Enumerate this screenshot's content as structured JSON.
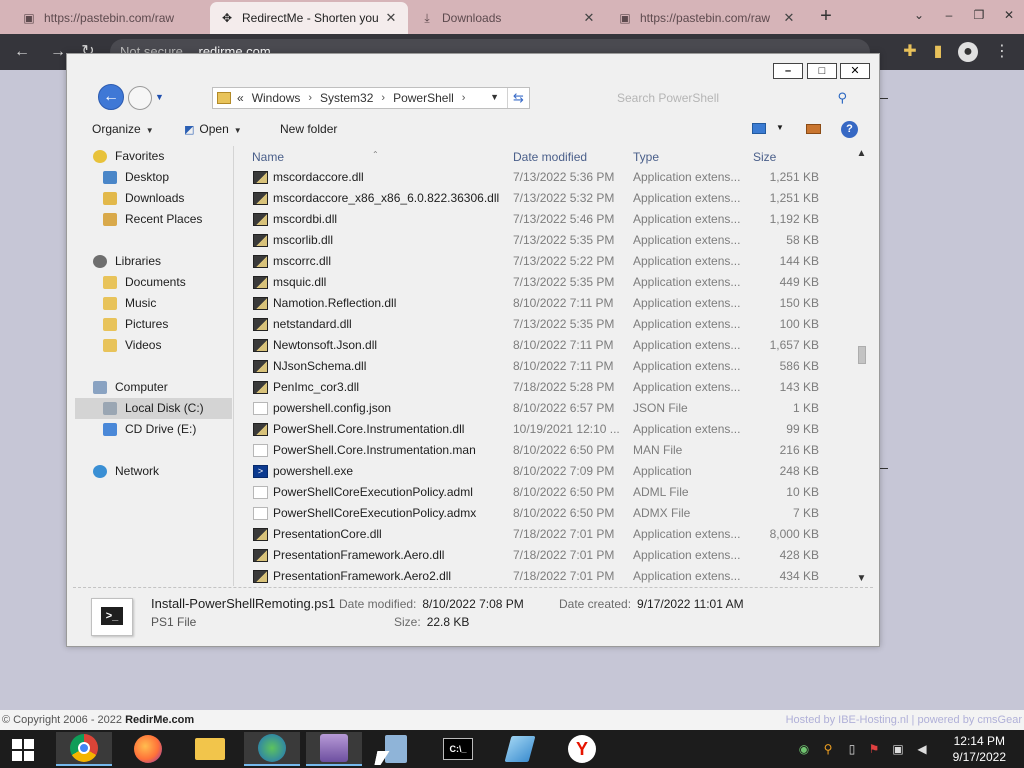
{
  "browser": {
    "tabs": [
      {
        "title": "https://pastebin.com/raw",
        "favicon": "pastebin-icon",
        "active": false
      },
      {
        "title": "RedirectMe - Shorten your",
        "favicon": "redirectme-icon",
        "active": true
      },
      {
        "title": "Downloads",
        "favicon": "download-icon",
        "active": false
      },
      {
        "title": "https://pastebin.com/raw",
        "favicon": "pastebin-icon",
        "active": false
      }
    ],
    "address": {
      "security": "Not secure",
      "url": "redirme.com"
    },
    "footer": {
      "copyright_prefix": "© Copyright 2006 - 2022",
      "copyright_brand": "RedirMe.com",
      "hosted": "Hosted by IBE-Hosting.nl",
      "sep": "|",
      "powered": "powered by cmsGear"
    }
  },
  "explorer": {
    "window_controls": {
      "minimize": "–",
      "maximize": "□",
      "close": "✕"
    },
    "breadcrumb": {
      "overflow": "«",
      "items": [
        "Windows",
        "System32",
        "PowerShell"
      ]
    },
    "search_placeholder": "Search PowerShell",
    "commands": {
      "organize": "Organize",
      "open": "Open",
      "new_folder": "New folder"
    },
    "nav": [
      {
        "label": "Favorites",
        "level": 0,
        "icon": "star-icon"
      },
      {
        "label": "Desktop",
        "level": 1,
        "icon": "desktop-icon"
      },
      {
        "label": "Downloads",
        "level": 1,
        "icon": "downloads-folder-icon"
      },
      {
        "label": "Recent Places",
        "level": 1,
        "icon": "recent-places-icon"
      },
      {
        "label": "Libraries",
        "level": 0,
        "icon": "libraries-icon"
      },
      {
        "label": "Documents",
        "level": 1,
        "icon": "documents-icon"
      },
      {
        "label": "Music",
        "level": 1,
        "icon": "music-icon"
      },
      {
        "label": "Pictures",
        "level": 1,
        "icon": "pictures-icon"
      },
      {
        "label": "Videos",
        "level": 1,
        "icon": "videos-icon"
      },
      {
        "label": "Computer",
        "level": 0,
        "icon": "computer-icon"
      },
      {
        "label": "Local Disk (C:)",
        "level": 1,
        "icon": "drive-icon",
        "selected": true
      },
      {
        "label": "CD Drive (E:)",
        "level": 1,
        "icon": "cd-drive-icon"
      },
      {
        "label": "Network",
        "level": 0,
        "icon": "network-icon"
      }
    ],
    "columns": {
      "name": "Name",
      "date": "Date modified",
      "type": "Type",
      "size": "Size"
    },
    "files": [
      {
        "name": "mscordaccore.dll",
        "date": "7/13/2022 5:36 PM",
        "type": "Application extens...",
        "size": "1,251 KB",
        "icon": "dll"
      },
      {
        "name": "mscordaccore_x86_x86_6.0.822.36306.dll",
        "date": "7/13/2022 5:32 PM",
        "type": "Application extens...",
        "size": "1,251 KB",
        "icon": "dll"
      },
      {
        "name": "mscordbi.dll",
        "date": "7/13/2022 5:46 PM",
        "type": "Application extens...",
        "size": "1,192 KB",
        "icon": "dll"
      },
      {
        "name": "mscorlib.dll",
        "date": "7/13/2022 5:35 PM",
        "type": "Application extens...",
        "size": "58 KB",
        "icon": "dll"
      },
      {
        "name": "mscorrc.dll",
        "date": "7/13/2022 5:22 PM",
        "type": "Application extens...",
        "size": "144 KB",
        "icon": "dll"
      },
      {
        "name": "msquic.dll",
        "date": "7/13/2022 5:35 PM",
        "type": "Application extens...",
        "size": "449 KB",
        "icon": "dll"
      },
      {
        "name": "Namotion.Reflection.dll",
        "date": "8/10/2022 7:11 PM",
        "type": "Application extens...",
        "size": "150 KB",
        "icon": "dll"
      },
      {
        "name": "netstandard.dll",
        "date": "7/13/2022 5:35 PM",
        "type": "Application extens...",
        "size": "100 KB",
        "icon": "dll"
      },
      {
        "name": "Newtonsoft.Json.dll",
        "date": "8/10/2022 7:11 PM",
        "type": "Application extens...",
        "size": "1,657 KB",
        "icon": "dll"
      },
      {
        "name": "NJsonSchema.dll",
        "date": "8/10/2022 7:11 PM",
        "type": "Application extens...",
        "size": "586 KB",
        "icon": "dll"
      },
      {
        "name": "PenImc_cor3.dll",
        "date": "7/18/2022 5:28 PM",
        "type": "Application extens...",
        "size": "143 KB",
        "icon": "dll"
      },
      {
        "name": "powershell.config.json",
        "date": "8/10/2022 6:57 PM",
        "type": "JSON File",
        "size": "1 KB",
        "icon": "blank"
      },
      {
        "name": "PowerShell.Core.Instrumentation.dll",
        "date": "10/19/2021 12:10 ...",
        "type": "Application extens...",
        "size": "99 KB",
        "icon": "dll"
      },
      {
        "name": "PowerShell.Core.Instrumentation.man",
        "date": "8/10/2022 6:50 PM",
        "type": "MAN File",
        "size": "216 KB",
        "icon": "blank"
      },
      {
        "name": "powershell.exe",
        "date": "8/10/2022 7:09 PM",
        "type": "Application",
        "size": "248 KB",
        "icon": "exe"
      },
      {
        "name": "PowerShellCoreExecutionPolicy.adml",
        "date": "8/10/2022 6:50 PM",
        "type": "ADML File",
        "size": "10 KB",
        "icon": "blank"
      },
      {
        "name": "PowerShellCoreExecutionPolicy.admx",
        "date": "8/10/2022 6:50 PM",
        "type": "ADMX File",
        "size": "7 KB",
        "icon": "blank"
      },
      {
        "name": "PresentationCore.dll",
        "date": "7/18/2022 7:01 PM",
        "type": "Application extens...",
        "size": "8,000 KB",
        "icon": "dll"
      },
      {
        "name": "PresentationFramework.Aero.dll",
        "date": "7/18/2022 7:01 PM",
        "type": "Application extens...",
        "size": "428 KB",
        "icon": "dll"
      },
      {
        "name": "PresentationFramework.Aero2.dll",
        "date": "7/18/2022 7:01 PM",
        "type": "Application extens...",
        "size": "434 KB",
        "icon": "dll"
      }
    ],
    "details": {
      "filename": "Install-PowerShellRemoting.ps1",
      "filetype": "PS1 File",
      "modified_label": "Date modified:",
      "modified_value": "8/10/2022 7:08 PM",
      "created_label": "Date created:",
      "created_value": "9/17/2022 11:01 AM",
      "size_label": "Size:",
      "size_value": "22.8 KB"
    }
  },
  "taskbar": {
    "apps": [
      "chrome-icon",
      "firefox-icon",
      "file-explorer-icon",
      "network-globe-icon",
      "archive-icon",
      "calculator-icon",
      "command-prompt-icon",
      "notepad-icon",
      "yandex-icon"
    ],
    "yandex_letter": "Y",
    "clock": {
      "time": "12:14 PM",
      "date": "9/17/2022"
    }
  }
}
